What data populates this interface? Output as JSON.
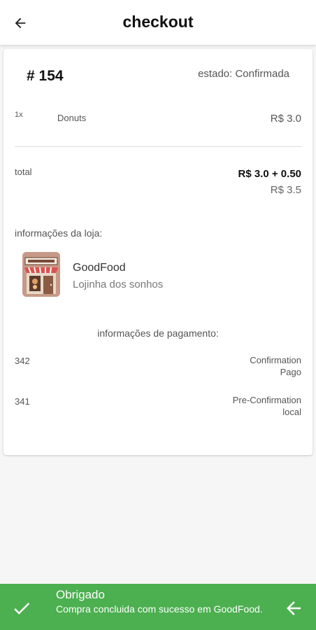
{
  "appbar": {
    "title": "checkout",
    "back_icon": "arrow-left-icon"
  },
  "order": {
    "number": "# 154",
    "status": "estado: Confirmada",
    "items": [
      {
        "qty": "1x",
        "name": "Donuts",
        "price": "R$ 3.0"
      }
    ],
    "total_label": "total",
    "total_formula": "R$ 3.0 + 0.50",
    "total_value": "R$ 3.5"
  },
  "store": {
    "heading": "informações da loja:",
    "name": "GoodFood",
    "description": "Lojinha dos sonhos",
    "logo_icon": "storefront-icon"
  },
  "payment": {
    "heading": "informações de pagamento:",
    "entries": [
      {
        "id": "342",
        "type": "Confirmation",
        "status": "Pago"
      },
      {
        "id": "341",
        "type": "Pre-Confirmation",
        "status": "local"
      }
    ]
  },
  "snackbar": {
    "title": "Obrigado",
    "message": "Compra concluida com sucesso em GoodFood.",
    "color": "#4caf50",
    "leading_icon": "check-icon",
    "action_icon": "arrow-left-icon"
  },
  "colors": {
    "background": "#f6f6f6",
    "card": "#ffffff",
    "accent_green": "#4caf50"
  }
}
